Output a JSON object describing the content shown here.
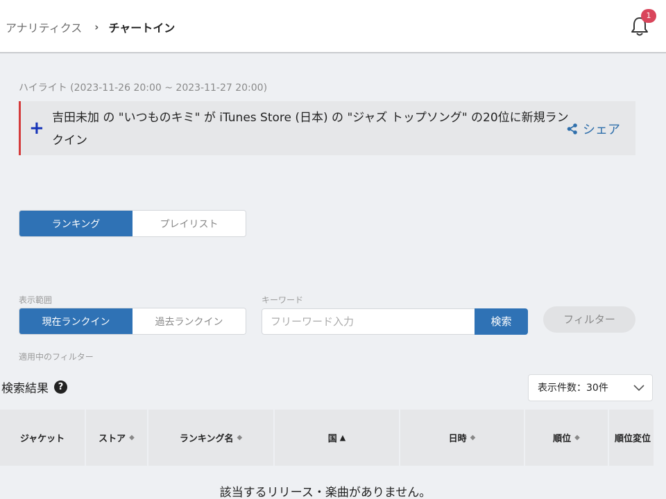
{
  "header": {
    "breadcrumb_parent": "アナリティクス",
    "breadcrumb_sep": "›",
    "breadcrumb_current": "チャートイン",
    "notification_count": "1"
  },
  "highlight": {
    "label": "ハイライト (2023-11-26 20:00 ~ 2023-11-27 20:00)",
    "plus": "+",
    "text": "吉田未加 の \"いつものキミ\" が iTunes Store (日本) の \"ジャズ トップソング\" の20位に新規ランクイン",
    "share_label": "シェア"
  },
  "type_tabs": [
    {
      "label": "ランキング",
      "active": true
    },
    {
      "label": "プレイリスト",
      "active": false
    }
  ],
  "range": {
    "label": "表示範囲",
    "options": [
      {
        "label": "現在ランクイン",
        "active": true
      },
      {
        "label": "過去ランクイン",
        "active": false
      }
    ]
  },
  "keyword": {
    "label": "キーワード",
    "placeholder": "フリーワード入力",
    "value": "",
    "search_label": "検索"
  },
  "filter_button": "フィルター",
  "applied_filters_label": "適用中のフィルター",
  "results": {
    "title": "検索結果",
    "help": "?",
    "per_page": "表示件数：30件"
  },
  "table": {
    "columns": [
      {
        "label": "ジャケット",
        "sort": ""
      },
      {
        "label": "ストア",
        "sort": "◆"
      },
      {
        "label": "ランキング名",
        "sort": "◆"
      },
      {
        "label": "国",
        "sort": "▲"
      },
      {
        "label": "日時",
        "sort": "◆"
      },
      {
        "label": "順位",
        "sort": "◆"
      },
      {
        "label": "順位変位",
        "sort": ""
      }
    ],
    "empty_message": "該当するリリース・楽曲がありません。"
  },
  "colors": {
    "primary": "#2f72b5",
    "accent_red": "#d43b3b",
    "badge": "#d9455b",
    "plus": "#1533b8",
    "share": "#2f6fab"
  }
}
